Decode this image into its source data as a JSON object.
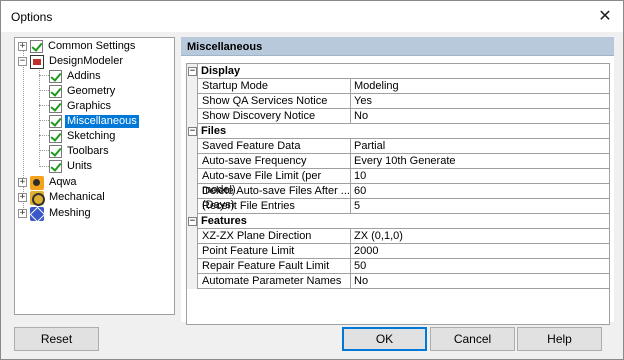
{
  "window": {
    "title": "Options",
    "close_label": "✕"
  },
  "tree": {
    "items": [
      {
        "label": "Common Settings"
      },
      {
        "label": "DesignModeler"
      },
      {
        "label": "Addins"
      },
      {
        "label": "Geometry"
      },
      {
        "label": "Graphics"
      },
      {
        "label": "Miscellaneous"
      },
      {
        "label": "Sketching"
      },
      {
        "label": "Toolbars"
      },
      {
        "label": "Units"
      },
      {
        "label": "Aqwa"
      },
      {
        "label": "Mechanical"
      },
      {
        "label": "Meshing"
      }
    ],
    "expand_plus": "+",
    "expand_minus": "−"
  },
  "panel": {
    "title": "Miscellaneous"
  },
  "grid": {
    "collapse_symbol": "−",
    "sections": [
      {
        "name": "Display",
        "rows": [
          {
            "name": "Startup Mode",
            "value": "Modeling"
          },
          {
            "name": "Show QA Services Notice",
            "value": "Yes"
          },
          {
            "name": "Show Discovery Notice",
            "value": "No"
          }
        ]
      },
      {
        "name": "Files",
        "rows": [
          {
            "name": "Saved Feature Data",
            "value": "Partial"
          },
          {
            "name": "Auto-save Frequency",
            "value": "Every 10th Generate"
          },
          {
            "name": "Auto-save File Limit (per model)",
            "value": "10"
          },
          {
            "name": "Delete Auto-save Files After ... (Days)",
            "value": "60"
          },
          {
            "name": "Recent File Entries",
            "value": "5"
          }
        ]
      },
      {
        "name": "Features",
        "rows": [
          {
            "name": "XZ-ZX Plane Direction",
            "value": "ZX (0,1,0)"
          },
          {
            "name": "Point Feature Limit",
            "value": "2000"
          },
          {
            "name": "Repair Feature Fault Limit",
            "value": "50"
          },
          {
            "name": "Automate Parameter Names",
            "value": "No"
          }
        ]
      }
    ]
  },
  "buttons": {
    "reset": "Reset",
    "ok": "OK",
    "cancel": "Cancel",
    "help": "Help"
  },
  "colors": {
    "selection": "#0078d7",
    "header_band": "#b8c9dc",
    "check_green": "#1a9a1a"
  }
}
